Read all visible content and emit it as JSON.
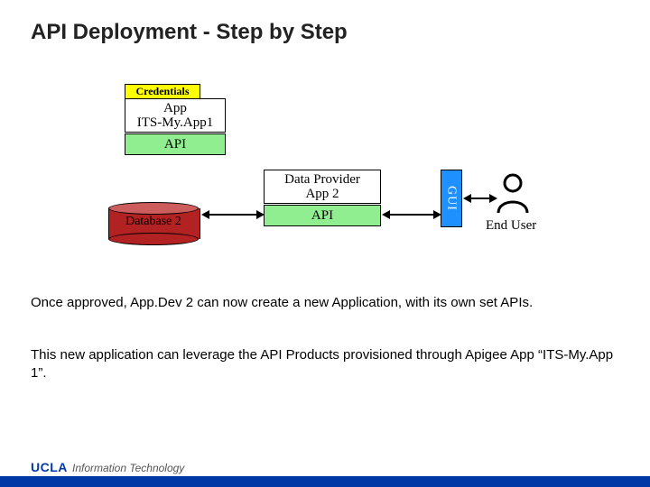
{
  "title": "API Deployment -  Step by Step",
  "top_group": {
    "credentials": "Credentials",
    "app_line1": "App",
    "app_line2": "ITS-My.App1",
    "api": "API"
  },
  "mid_group": {
    "dp_line1": "Data Provider",
    "dp_line2": "App 2",
    "api": "API",
    "gui": "GUI",
    "end_user": "End User",
    "database": "Database 2"
  },
  "paragraph1": "Once approved, App.Dev 2 can now create a new Application, with its own set APIs.",
  "paragraph2": "This new application can leverage the API Products provisioned through Apigee App “ITS-My.App 1”.",
  "footer": {
    "logo": "UCLA",
    "text": "Information Technology"
  },
  "colors": {
    "credentials_bg": "#ffff00",
    "api_bg": "#90ee90",
    "gui_bg": "#1e90ff",
    "db_fill": "#b22222",
    "footer_bg": "#0039a6"
  }
}
